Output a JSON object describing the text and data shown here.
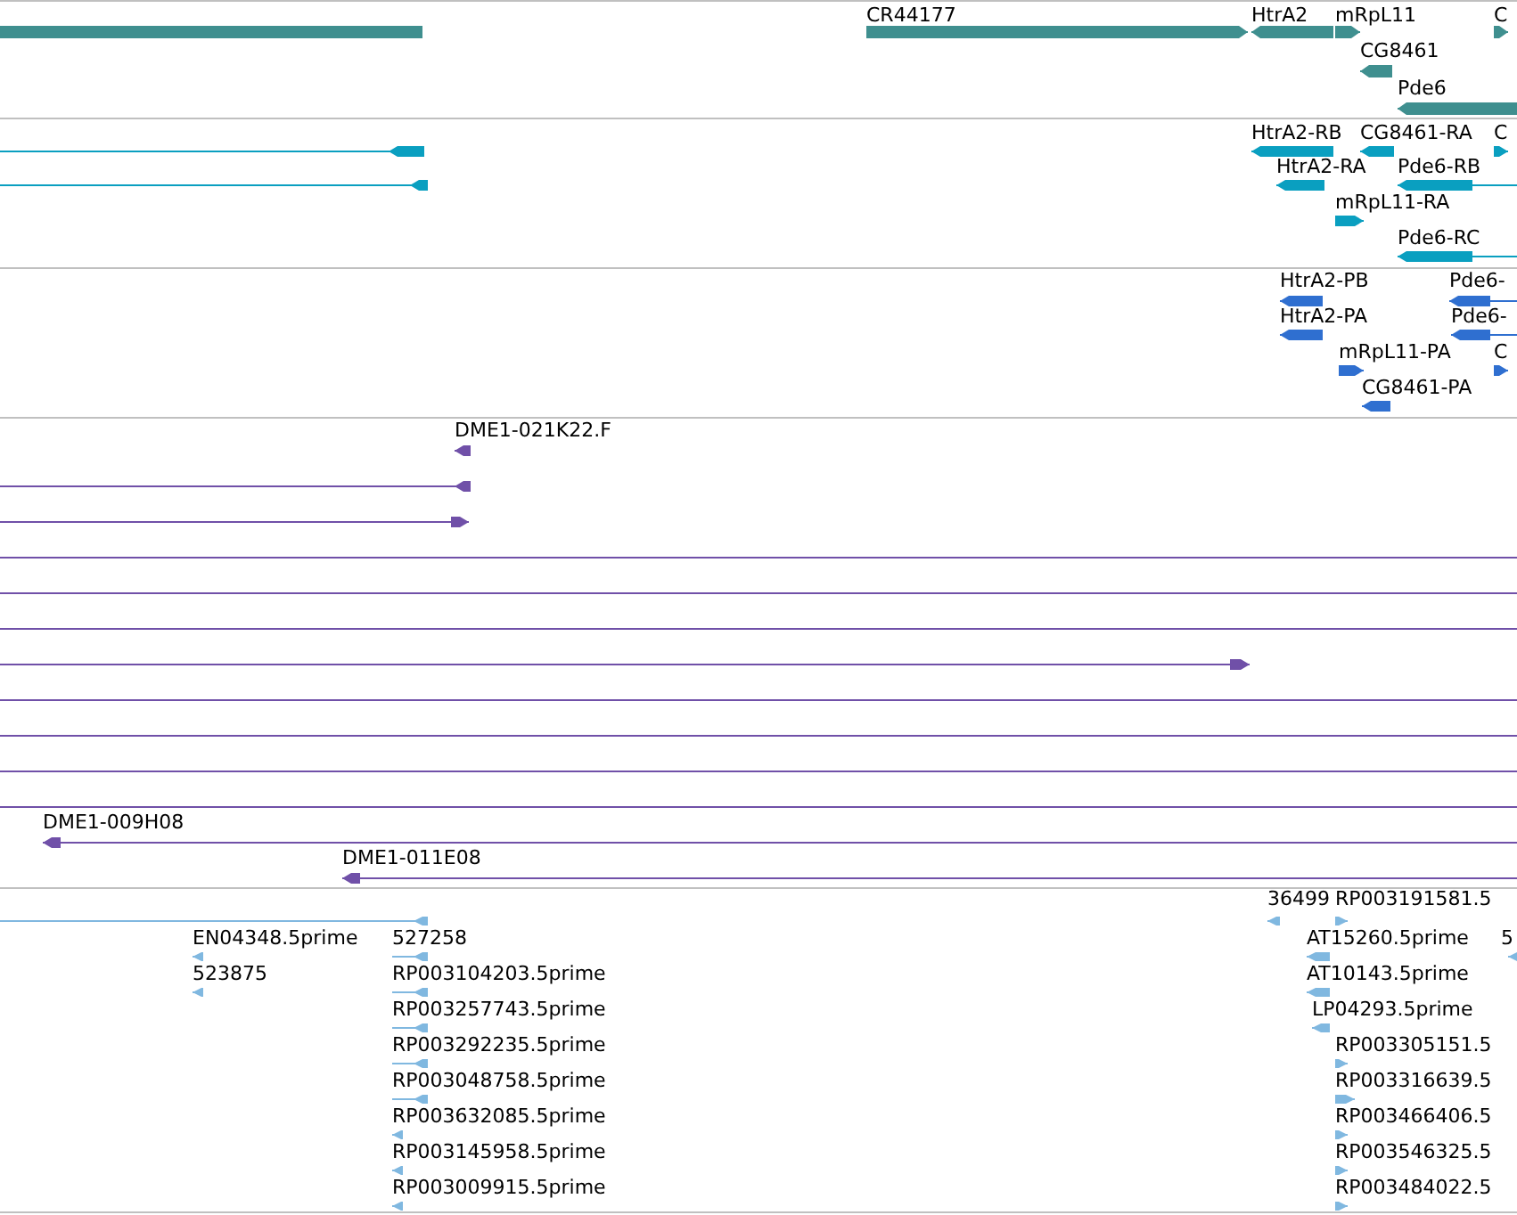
{
  "tracks": [
    {
      "color": "#3f8f8f",
      "features": [
        {
          "kind": "feature",
          "reverse": true
        },
        {
          "kind": "feature",
          "label": "CR44177",
          "reverse": false
        },
        {
          "kind": "feature",
          "label": "HtrA2",
          "reverse": true
        },
        {
          "kind": "feature",
          "label": "mRpL11",
          "reverse": false
        },
        {
          "kind": "feature",
          "label": "C",
          "reverse": false
        },
        {
          "kind": "feature",
          "label": "CG8461",
          "reverse": true
        },
        {
          "kind": "feature",
          "label": "Pde6",
          "reverse": true
        }
      ]
    },
    {
      "color": "#0a9fc0",
      "features": [
        {
          "kind": "feature",
          "reverse": true
        },
        {
          "kind": "feature",
          "reverse": true
        },
        {
          "kind": "feature",
          "label": "HtrA2-RB",
          "reverse": true
        },
        {
          "kind": "feature",
          "label": "CG8461-RA",
          "reverse": true
        },
        {
          "kind": "feature",
          "label": "C",
          "reverse": false
        },
        {
          "kind": "feature",
          "label": "HtrA2-RA",
          "reverse": true
        },
        {
          "kind": "feature",
          "label": "Pde6-RB",
          "reverse": true
        },
        {
          "kind": "feature",
          "label": "mRpL11-RA",
          "reverse": false
        },
        {
          "kind": "feature",
          "label": "Pde6-RC",
          "reverse": true
        }
      ]
    },
    {
      "color": "#2f6fd0",
      "features": [
        {
          "kind": "feature",
          "label": "HtrA2-PB",
          "reverse": true
        },
        {
          "kind": "feature",
          "label": "Pde6-",
          "reverse": true
        },
        {
          "kind": "feature",
          "label": "HtrA2-PA",
          "reverse": true
        },
        {
          "kind": "feature",
          "label": "Pde6-",
          "reverse": true
        },
        {
          "kind": "feature",
          "label": "mRpL11-PA",
          "reverse": false
        },
        {
          "kind": "feature",
          "label": "C",
          "reverse": false
        },
        {
          "kind": "feature",
          "label": "CG8461-PA",
          "reverse": true
        }
      ]
    },
    {
      "color": "#7050a8",
      "features": [
        {
          "kind": "feature",
          "label": "DME1-021K22.F",
          "reverse": true
        },
        {
          "kind": "feature",
          "reverse": true
        },
        {
          "kind": "feature",
          "reverse": false
        },
        {
          "kind": "span"
        },
        {
          "kind": "span"
        },
        {
          "kind": "span"
        },
        {
          "kind": "feature",
          "reverse": false
        },
        {
          "kind": "span"
        },
        {
          "kind": "span"
        },
        {
          "kind": "span"
        },
        {
          "kind": "span"
        },
        {
          "kind": "feature",
          "label": "DME1-009H08",
          "reverse": true
        },
        {
          "kind": "feature",
          "label": "DME1-011E08",
          "reverse": true
        }
      ]
    },
    {
      "color": "#80b8e0",
      "features": [
        {
          "kind": "feature",
          "label": "36499",
          "reverse": true
        },
        {
          "kind": "feature",
          "label": "RP003191581.5",
          "reverse": false
        },
        {
          "kind": "feature",
          "reverse": true
        },
        {
          "kind": "feature",
          "label": "EN04348.5prime",
          "reverse": true
        },
        {
          "kind": "feature",
          "label": "527258",
          "reverse": true
        },
        {
          "kind": "feature",
          "label": "AT15260.5prime",
          "reverse": true
        },
        {
          "kind": "feature",
          "label": "5",
          "reverse": true
        },
        {
          "kind": "feature",
          "label": "523875",
          "reverse": true
        },
        {
          "kind": "feature",
          "label": "RP003104203.5prime",
          "reverse": true
        },
        {
          "kind": "feature",
          "label": "AT10143.5prime",
          "reverse": true
        },
        {
          "kind": "feature",
          "label": "RP003257743.5prime",
          "reverse": true
        },
        {
          "kind": "feature",
          "label": "LP04293.5prime",
          "reverse": true
        },
        {
          "kind": "feature",
          "label": "RP003292235.5prime",
          "reverse": true
        },
        {
          "kind": "feature",
          "label": "RP003305151.5",
          "reverse": false
        },
        {
          "kind": "feature",
          "label": "RP003048758.5prime",
          "reverse": true
        },
        {
          "kind": "feature",
          "label": "RP003316639.5",
          "reverse": false
        },
        {
          "kind": "feature",
          "label": "RP003632085.5prime",
          "reverse": true
        },
        {
          "kind": "feature",
          "label": "RP003466406.5",
          "reverse": false
        },
        {
          "kind": "feature",
          "label": "RP003145958.5prime",
          "reverse": true
        },
        {
          "kind": "feature",
          "label": "RP003546325.5",
          "reverse": false
        },
        {
          "kind": "feature",
          "label": "RP003009915.5prime",
          "reverse": true
        },
        {
          "kind": "feature",
          "label": "RP003484022.5",
          "reverse": false
        }
      ]
    }
  ]
}
